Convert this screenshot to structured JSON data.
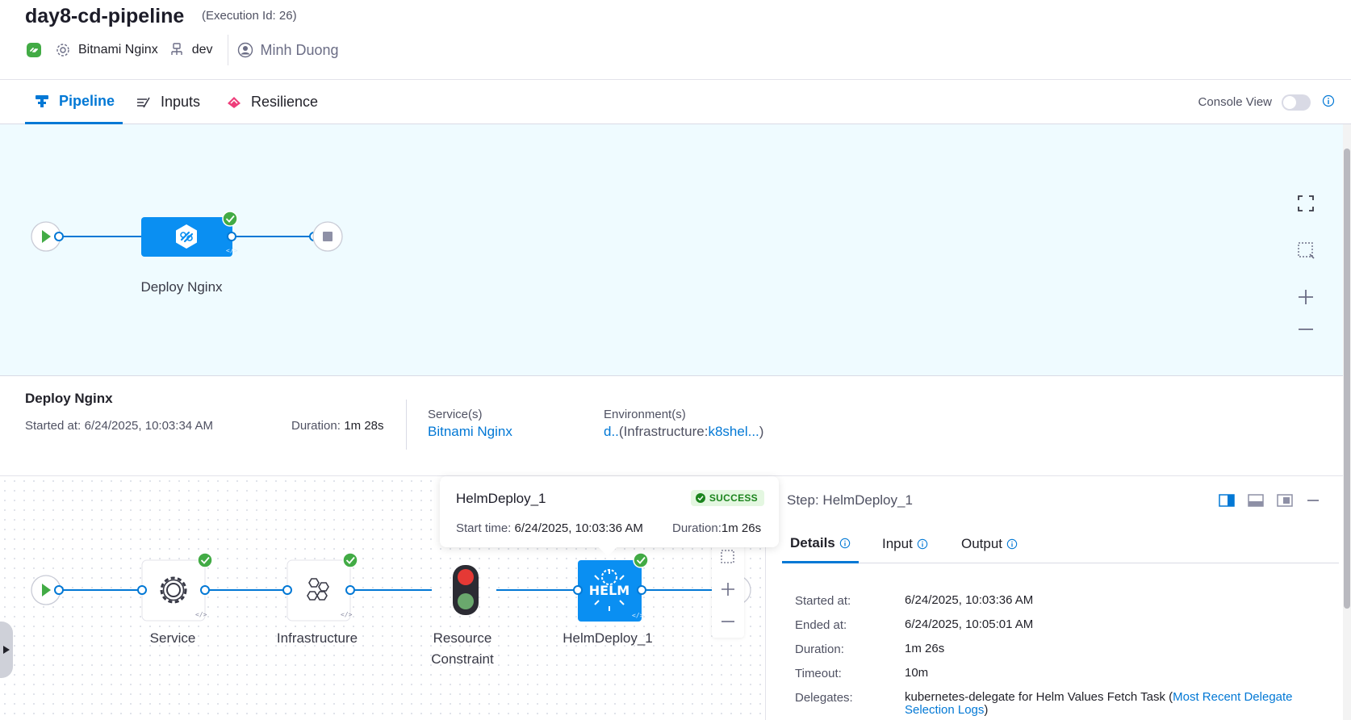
{
  "header": {
    "title": "day8-cd-pipeline",
    "execution_id": "(Execution Id: 26)",
    "service": "Bitnami Nginx",
    "environment": "dev",
    "user": "Minh Duong"
  },
  "tabs": [
    {
      "label": "Pipeline",
      "icon": "pipeline-icon",
      "active": true
    },
    {
      "label": "Inputs",
      "icon": "inputs-icon",
      "active": false
    },
    {
      "label": "Resilience",
      "icon": "resilience-icon",
      "active": false
    }
  ],
  "console_view": {
    "label": "Console View",
    "enabled": false
  },
  "top_graph": {
    "stage_label": "Deploy Nginx",
    "stage_status": "success"
  },
  "stage_info": {
    "title": "Deploy Nginx",
    "started_label": "Started at:",
    "started_value": "6/24/2025, 10:03:34 AM",
    "duration_label": "Duration:",
    "duration_value": "1m 28s",
    "services_label": "Service(s)",
    "services_value": "Bitnami Nginx",
    "env_label": "Environment(s)",
    "env_prefix": "d..",
    "env_infra_open": "(Infrastructure:",
    "env_infra_link": "k8shel...",
    "env_infra_close": ")"
  },
  "bottom_graph": {
    "steps": [
      {
        "label": "Service",
        "status": "success"
      },
      {
        "label": "Infrastructure",
        "status": "success"
      },
      {
        "label": "Resource\nConstraint",
        "status": "none"
      },
      {
        "label": "HelmDeploy_1",
        "status": "success"
      }
    ],
    "helm_text": "HELM"
  },
  "tooltip": {
    "name": "HelmDeploy_1",
    "badge": "SUCCESS",
    "start_label": "Start time:",
    "start_value": "6/24/2025, 10:03:36 AM",
    "duration_label": "Duration:",
    "duration_value": "1m 26s"
  },
  "details": {
    "step_title": "Step: HelmDeploy_1",
    "tabs": [
      "Details",
      "Input",
      "Output"
    ],
    "rows": {
      "started_label": "Started at:",
      "started_value": "6/24/2025, 10:03:36 AM",
      "ended_label": "Ended at:",
      "ended_value": "6/24/2025, 10:05:01 AM",
      "duration_label": "Duration:",
      "duration_value": "1m 26s",
      "timeout_label": "Timeout:",
      "timeout_value": "10m",
      "delegates_label": "Delegates:",
      "delegates_text": "kubernetes-delegate for Helm Values Fetch Task (",
      "delegates_link": "Most Recent Delegate Selection Logs",
      "delegates_close": ")"
    }
  },
  "colors": {
    "accent": "#0278d5",
    "success": "#42ab45",
    "canvas_bg": "#effbff",
    "node_blue": "#0a8ff2"
  }
}
